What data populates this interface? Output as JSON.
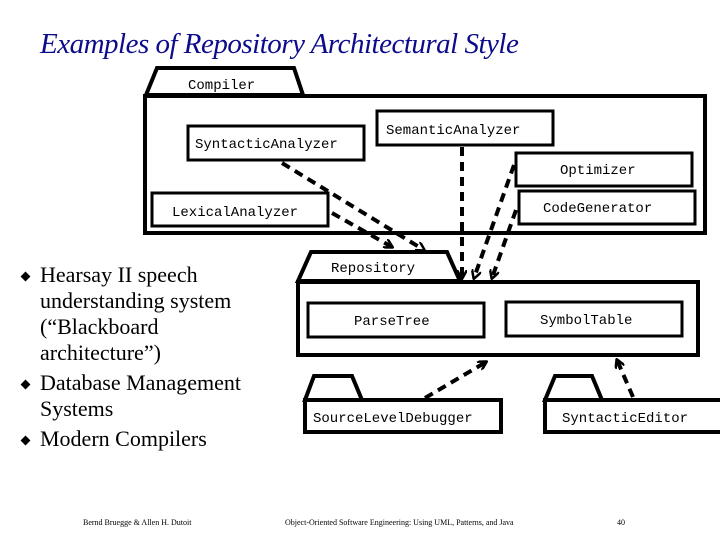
{
  "slide": {
    "title": "Examples of Repository Architectural Style",
    "bullets": [
      "Hearsay II speech understanding system (“Blackboard architecture”)",
      "Database Management Systems",
      "Modern Compilers"
    ],
    "footer": {
      "authors": "Bernd Bruegge & Allen H. Dutoit",
      "book": "Object-Oriented Software Engineering: Using UML, Patterns, and Java",
      "page": "40"
    }
  },
  "diagram": {
    "packages": {
      "compiler": "Compiler",
      "repository": "Repository",
      "debugger": "SourceLevelDebugger",
      "editor": "SyntacticEditor"
    },
    "classes": {
      "syntactic_analyzer": "SyntacticAnalyzer",
      "semantic_analyzer": "SemanticAnalyzer",
      "optimizer": "Optimizer",
      "lexical_analyzer": "LexicalAnalyzer",
      "code_generator": "CodeGenerator",
      "parse_tree": "ParseTree",
      "symbol_table": "SymbolTable"
    },
    "dependencies": [
      {
        "from": "SyntacticAnalyzer",
        "to": "Repository"
      },
      {
        "from": "LexicalAnalyzer",
        "to": "Repository"
      },
      {
        "from": "SemanticAnalyzer",
        "to": "Repository"
      },
      {
        "from": "Optimizer",
        "to": "Repository"
      },
      {
        "from": "CodeGenerator",
        "to": "Repository"
      },
      {
        "from": "SourceLevelDebugger",
        "to": "Repository"
      },
      {
        "from": "SyntacticEditor",
        "to": "Repository"
      }
    ]
  }
}
